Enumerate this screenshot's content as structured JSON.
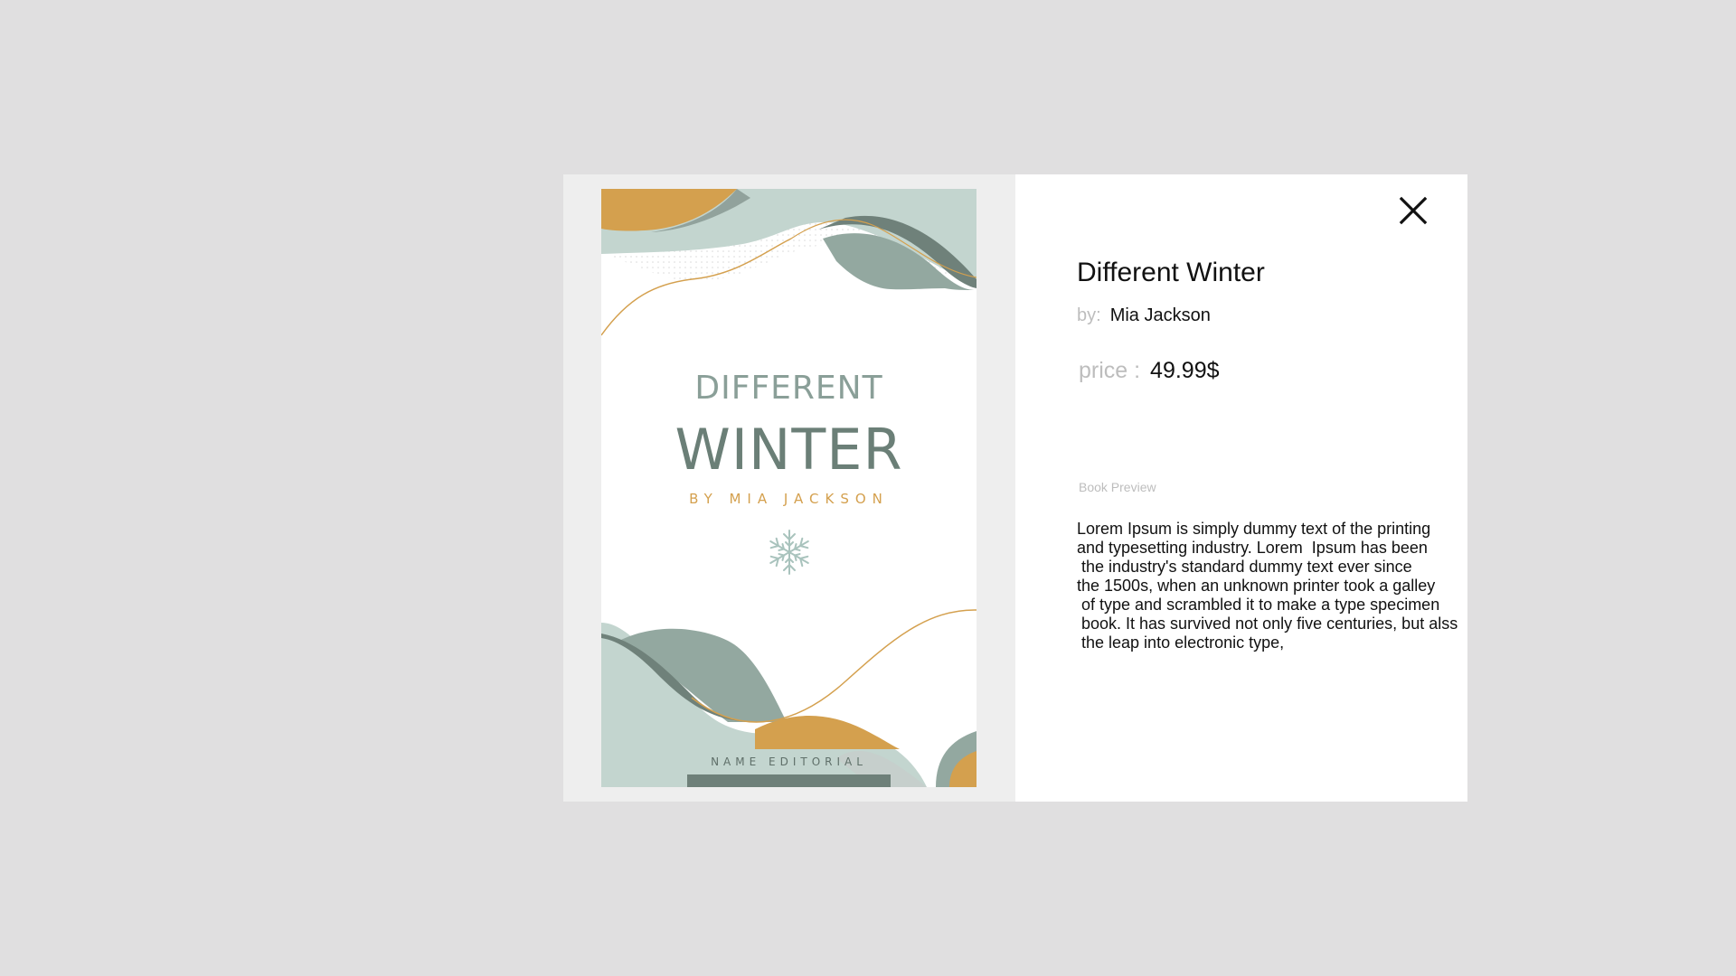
{
  "cover": {
    "title_line1": "DIFFERENT",
    "title_line2": "WINTER",
    "author": "BY MIA JACKSON",
    "publisher": "NAME EDITORIAL",
    "colors": {
      "sage": "#c3d5cf",
      "sage_dark": "#93a8a0",
      "gold": "#d4a04e",
      "title_dark": "#6b7f77"
    }
  },
  "details": {
    "title": "Different Winter",
    "by_label": "by:",
    "author": "Mia Jackson",
    "price_label": "price :",
    "price_value": "49.99$",
    "preview_label": "Book Preview",
    "preview_lines": [
      "Lorem Ipsum is simply dummy text of the printing",
      "and typesetting industry. Lorem  Ipsum has been",
      " the industry's standard dummy text ever since",
      "the 1500s, when an unknown printer took a galley",
      " of type and scrambled it to make a type specimen",
      " book. It has survived not only five centuries, but alss",
      " the leap into electronic type,"
    ]
  },
  "close_icon": "close-icon"
}
